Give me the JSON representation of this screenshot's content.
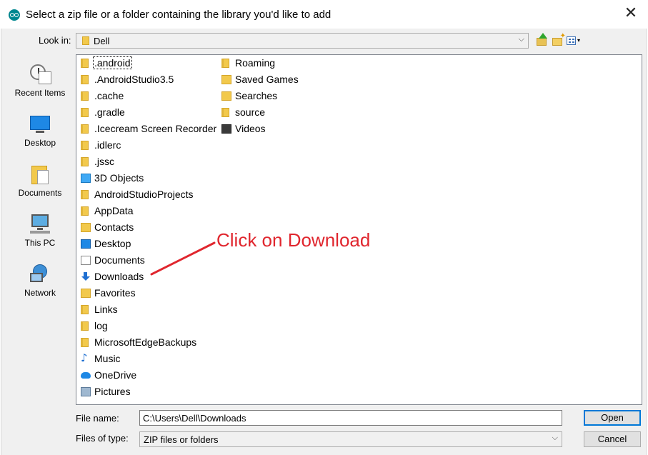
{
  "window": {
    "title": "Select a zip file or a folder containing the library you'd like to add",
    "close_glyph": "✕"
  },
  "toolbar": {
    "look_in_label": "Look in:",
    "look_in_value": "Dell",
    "dropdown_glyph": "⌵",
    "view_dropdown_glyph": "▾"
  },
  "places": [
    {
      "label": "Recent Items",
      "icon": "recent-items-icon"
    },
    {
      "label": "Desktop",
      "icon": "desktop-icon"
    },
    {
      "label": "Documents",
      "icon": "documents-icon"
    },
    {
      "label": "This PC",
      "icon": "this-pc-icon"
    },
    {
      "label": "Network",
      "icon": "network-icon"
    }
  ],
  "files": {
    "column1": [
      {
        "name": ".android",
        "icon": "folder-icon",
        "selected": true
      },
      {
        "name": ".AndroidStudio3.5",
        "icon": "folder-icon"
      },
      {
        "name": ".cache",
        "icon": "folder-icon"
      },
      {
        "name": ".gradle",
        "icon": "folder-icon"
      },
      {
        "name": ".Icecream Screen Recorder",
        "icon": "folder-icon"
      },
      {
        "name": ".idlerc",
        "icon": "folder-icon"
      },
      {
        "name": ".jssc",
        "icon": "folder-icon"
      },
      {
        "name": "3D Objects",
        "icon": "3d-objects-icon"
      },
      {
        "name": "AndroidStudioProjects",
        "icon": "folder-icon"
      },
      {
        "name": "AppData",
        "icon": "folder-icon"
      },
      {
        "name": "Contacts",
        "icon": "contacts-icon"
      },
      {
        "name": "Desktop",
        "icon": "desktop-folder-icon"
      },
      {
        "name": "Documents",
        "icon": "documents-folder-icon"
      },
      {
        "name": "Downloads",
        "icon": "downloads-icon"
      },
      {
        "name": "Favorites",
        "icon": "favorites-icon"
      },
      {
        "name": "Links",
        "icon": "links-icon"
      },
      {
        "name": "log",
        "icon": "folder-icon"
      },
      {
        "name": "MicrosoftEdgeBackups",
        "icon": "folder-icon"
      },
      {
        "name": "Music",
        "icon": "music-icon"
      },
      {
        "name": "OneDrive",
        "icon": "onedrive-icon"
      },
      {
        "name": "Pictures",
        "icon": "pictures-icon"
      }
    ],
    "column2": [
      {
        "name": "Roaming",
        "icon": "folder-icon"
      },
      {
        "name": "Saved Games",
        "icon": "saved-games-icon"
      },
      {
        "name": "Searches",
        "icon": "searches-icon"
      },
      {
        "name": "source",
        "icon": "folder-icon"
      },
      {
        "name": "Videos",
        "icon": "videos-icon"
      }
    ]
  },
  "annotation": {
    "text": "Click on Download",
    "color": "#e0262e"
  },
  "form": {
    "file_name_label": "File name:",
    "file_name_value": "C:\\Users\\Dell\\Downloads",
    "files_of_type_label": "Files of type:",
    "files_of_type_value": "ZIP files or folders",
    "open_label": "Open",
    "cancel_label": "Cancel"
  }
}
